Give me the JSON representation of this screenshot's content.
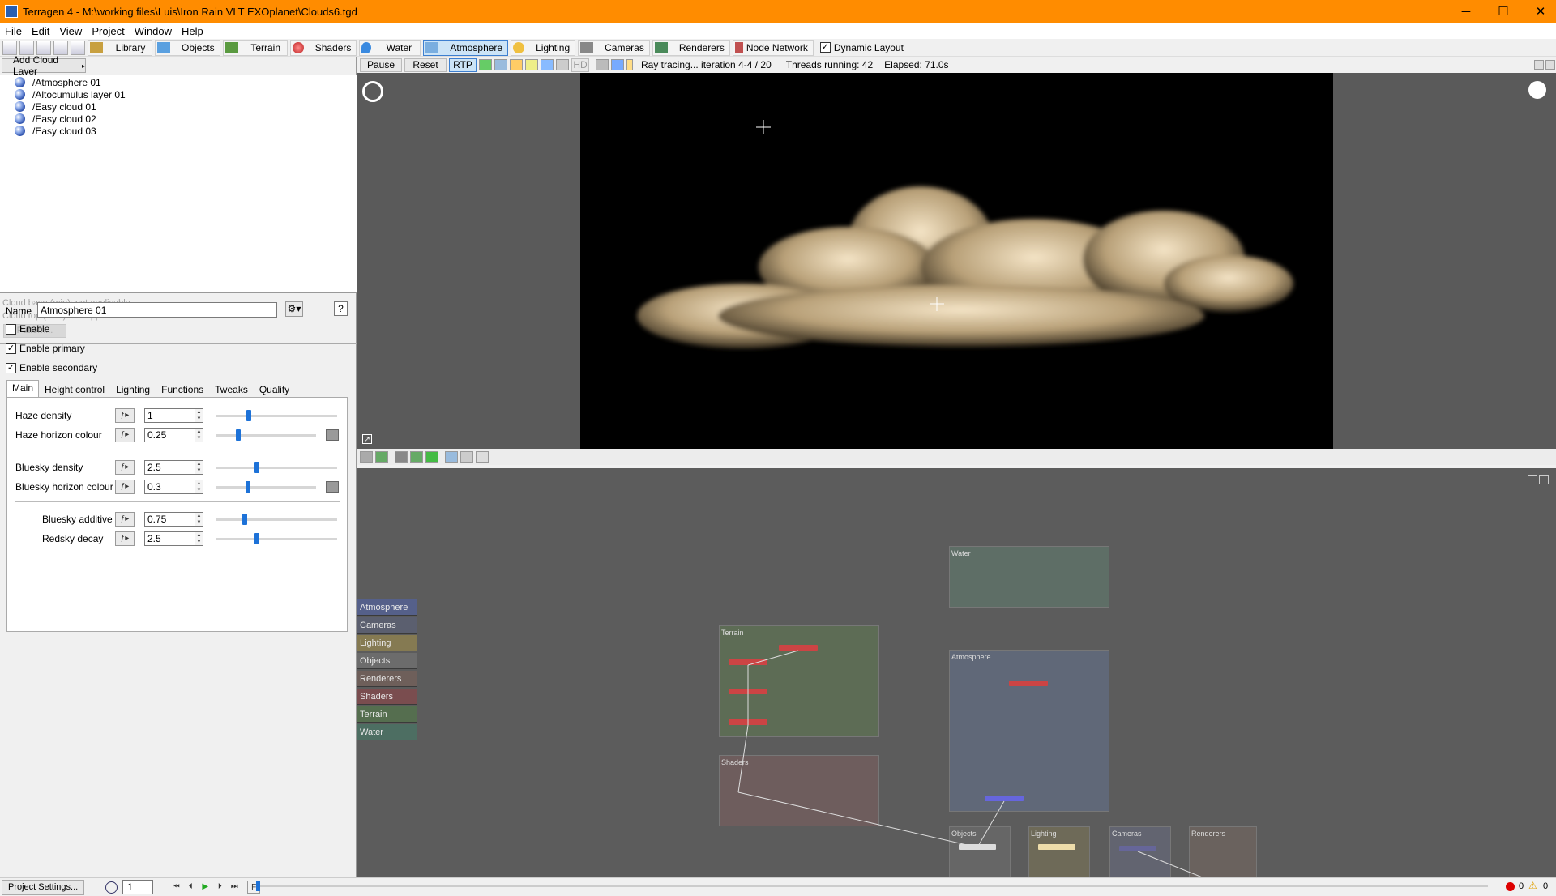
{
  "window": {
    "title": "Terragen 4 - M:\\working files\\Luis\\Iron Rain VLT EXOplanet\\Clouds6.tgd",
    "minimize": "─",
    "maximize": "☐",
    "close": "✕"
  },
  "menu": [
    "File",
    "Edit",
    "View",
    "Project",
    "Window",
    "Help"
  ],
  "toolbar": {
    "buttons": [
      {
        "label": "Library",
        "active": false
      },
      {
        "label": "Objects",
        "active": false
      },
      {
        "label": "Terrain",
        "active": false
      },
      {
        "label": "Shaders",
        "active": false
      },
      {
        "label": "Water",
        "active": false
      },
      {
        "label": "Atmosphere",
        "active": true
      },
      {
        "label": "Lighting",
        "active": false
      },
      {
        "label": "Cameras",
        "active": false
      },
      {
        "label": "Renderers",
        "active": false
      },
      {
        "label": "Node Network",
        "active": false
      }
    ],
    "dynamic_layout": {
      "label": "Dynamic Layout",
      "checked": true
    }
  },
  "left": {
    "add_cloud_layer": "Add Cloud Layer",
    "tree": [
      "/Atmosphere 01",
      "/Altocumulus layer 01",
      "/Easy cloud 01",
      "/Easy cloud 02",
      "/Easy cloud 03"
    ],
    "cloud_base": "Cloud base (min): not applicable",
    "cloud_top": "Cloud top (max): not applicable",
    "pattern_button": "Pattern...",
    "name_label": "Name",
    "name_value": "Atmosphere 01",
    "help": "?",
    "enable": {
      "label": "Enable",
      "checked": false
    },
    "enable_primary": {
      "label": "Enable primary",
      "checked": true
    },
    "enable_secondary": {
      "label": "Enable secondary",
      "checked": true
    },
    "tabs": [
      {
        "label": "Main",
        "active": true
      },
      {
        "label": "Height control",
        "active": false
      },
      {
        "label": "Lighting",
        "active": false
      },
      {
        "label": "Functions",
        "active": false
      },
      {
        "label": "Tweaks",
        "active": false
      },
      {
        "label": "Quality",
        "active": false
      }
    ],
    "params": [
      {
        "label": "Haze density",
        "value": "1",
        "slider": 0.25,
        "swatch": false
      },
      {
        "label": "Haze horizon colour",
        "value": "0.25",
        "slider": 0.2,
        "swatch": true
      },
      {
        "label": "Bluesky density",
        "value": "2.5",
        "slider": 0.32,
        "swatch": false
      },
      {
        "label": "Bluesky horizon colour",
        "value": "0.3",
        "slider": 0.3,
        "swatch": true
      },
      {
        "label": "Bluesky additive",
        "value": "0.75",
        "slider": 0.22,
        "swatch": false
      },
      {
        "label": "Redsky decay",
        "value": "2.5",
        "slider": 0.32,
        "swatch": false
      }
    ]
  },
  "render": {
    "pause": "Pause",
    "reset": "Reset",
    "rtp": "RTP",
    "hd": "HD",
    "status": "Ray tracing... iteration 4-4 / 20",
    "threads": "Threads running: 42",
    "elapsed": "Elapsed: 71.0s"
  },
  "graph": {
    "categories": [
      {
        "label": "Atmosphere",
        "color": "#55608a"
      },
      {
        "label": "Cameras",
        "color": "#5b5f6f"
      },
      {
        "label": "Lighting",
        "color": "#857a52"
      },
      {
        "label": "Objects",
        "color": "#6c6c6c"
      },
      {
        "label": "Renderers",
        "color": "#6e5f5a"
      },
      {
        "label": "Shaders",
        "color": "#7a4d4f"
      },
      {
        "label": "Terrain",
        "color": "#556e4f"
      },
      {
        "label": "Water",
        "color": "#4d6e62"
      }
    ],
    "boxes": {
      "water": "Water",
      "terrain": "Terrain",
      "atmosphere": "Atmosphere",
      "shaders": "Shaders",
      "objects": "Objects",
      "lighting": "Lighting",
      "cameras": "Cameras",
      "renderers": "Renderers"
    }
  },
  "bottom": {
    "project_settings": "Project Settings...",
    "frame": "1",
    "errors": "0",
    "warnings": "0"
  }
}
